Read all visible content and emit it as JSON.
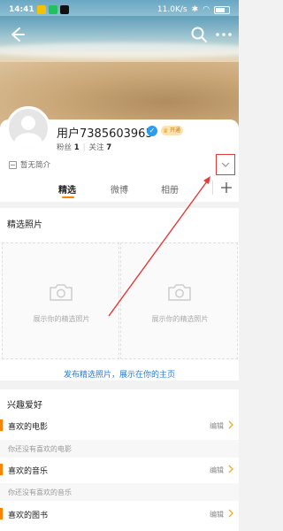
{
  "status_bar": {
    "time": "14:41",
    "network": "11.0K/s",
    "battery": "97"
  },
  "profile": {
    "username": "用户7385603965",
    "vip_label": "开通",
    "fans_label": "粉丝",
    "fans_count": "1",
    "follow_label": "关注",
    "follow_count": "7",
    "intro": "暂无简介"
  },
  "tabs": [
    {
      "label": "精选",
      "active": true
    },
    {
      "label": "微博",
      "active": false
    },
    {
      "label": "相册",
      "active": false
    }
  ],
  "featured": {
    "title": "精选照片",
    "placeholder": "展示你的精选照片",
    "publish_link": "发布精选照片，展示在你的主页"
  },
  "interests": {
    "title": "兴趣爱好",
    "edit_label": "编辑",
    "rows": [
      {
        "label": "喜欢的电影",
        "empty": "你还没有喜欢的电影"
      },
      {
        "label": "喜欢的音乐",
        "empty": "你还没有喜欢的音乐"
      },
      {
        "label": "喜欢的图书"
      }
    ]
  },
  "colors": {
    "accent": "#ff8200",
    "link": "#2b7bd6",
    "annotation": "#e23b3b"
  }
}
